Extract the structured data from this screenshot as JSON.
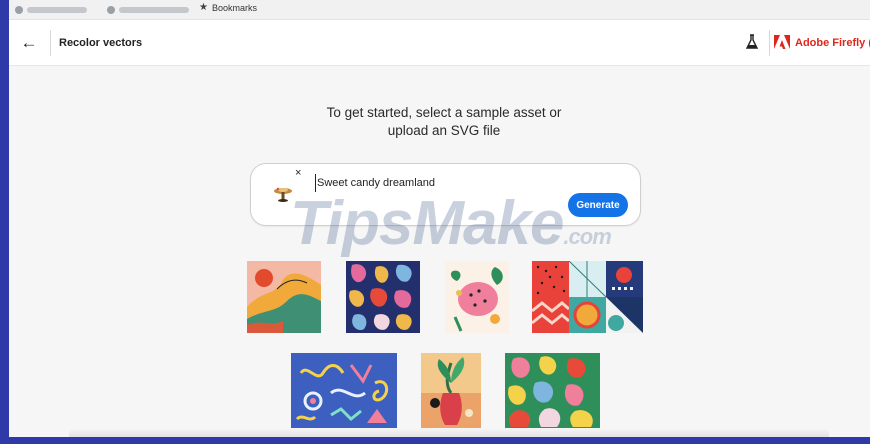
{
  "browser": {
    "bookmarks_label": "Bookmarks"
  },
  "header": {
    "page_title": "Recolor vectors",
    "brand_name": "Adobe Firefly (Beta)"
  },
  "intro": {
    "line1": "To get started, select a sample asset or",
    "line2": "upload an SVG file"
  },
  "prompt": {
    "value": "Sweet candy dreamland",
    "remove_label": "×",
    "generate_label": "Generate"
  },
  "watermark": {
    "main": "TipsMake",
    "suffix": ".com"
  },
  "icons": {
    "back": "arrow-left-icon",
    "flask": "flask-icon",
    "adobe": "adobe-logo",
    "star": "star-icon"
  },
  "colors": {
    "accent": "#1473e6",
    "brand": "#e1251b",
    "border": "#2f3aa8"
  }
}
